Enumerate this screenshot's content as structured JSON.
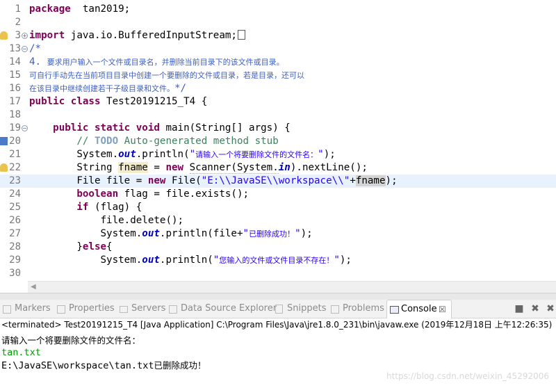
{
  "editor": {
    "lines": [
      {
        "num": "1",
        "tokens": [
          [
            "kw",
            "package"
          ],
          [
            "",
            "  tan2019;"
          ]
        ]
      },
      {
        "num": "2",
        "tokens": []
      },
      {
        "num": "3",
        "tokens": [
          [
            "kw",
            "import"
          ],
          [
            "",
            " java.io.BufferedInputStream;"
          ]
        ]
      },
      {
        "num": "13",
        "tokens": [
          [
            "jd",
            "/*"
          ]
        ]
      },
      {
        "num": "14",
        "tokens": [
          [
            "jd",
            "4. "
          ],
          [
            "jd cjk",
            "要求用户输入一个文件或目录名，并删除当前目录下的该文件或目录。"
          ]
        ]
      },
      {
        "num": "15",
        "tokens": [
          [
            "jd cjk",
            "可自行手动先在当前项目目录中创建一个要删除的文件或目录，若是目录，还可以"
          ]
        ]
      },
      {
        "num": "16",
        "tokens": [
          [
            "jd cjk",
            "在该目录中继续创建若干子级目录和文件。"
          ],
          [
            "jd",
            "*/"
          ]
        ]
      },
      {
        "num": "17",
        "tokens": [
          [
            "kw",
            "public"
          ],
          [
            "",
            " "
          ],
          [
            "kw",
            "class"
          ],
          [
            "",
            " Test20191215_T4 {"
          ]
        ]
      },
      {
        "num": "18",
        "tokens": []
      },
      {
        "num": "19",
        "tokens": [
          [
            "",
            "    "
          ],
          [
            "kw",
            "public"
          ],
          [
            "",
            " "
          ],
          [
            "kw",
            "static"
          ],
          [
            "",
            " "
          ],
          [
            "kw",
            "void"
          ],
          [
            "",
            " main(String[] args) {"
          ]
        ]
      },
      {
        "num": "20",
        "tokens": [
          [
            "",
            "        "
          ],
          [
            "cm",
            "// "
          ],
          [
            "cmtag",
            "TODO"
          ],
          [
            "cm",
            " Auto-generated method stub"
          ]
        ]
      },
      {
        "num": "21",
        "tokens": [
          [
            "",
            "        System."
          ],
          [
            "fld",
            "out"
          ],
          [
            "",
            ".println("
          ],
          [
            "str",
            "\""
          ],
          [
            "str cjk",
            "请输入一个将要删除文件的文件名："
          ],
          [
            "str",
            "\""
          ],
          [
            "",
            ");"
          ]
        ]
      },
      {
        "num": "22",
        "tokens": [
          [
            "",
            "        String "
          ],
          [
            "hlv",
            "fname"
          ],
          [
            "",
            " = "
          ],
          [
            "kw",
            "new"
          ],
          [
            "",
            " "
          ],
          [
            "warnu",
            "Scanner(System."
          ],
          [
            "fld",
            "in"
          ],
          [
            "",
            ").nextLine();"
          ]
        ]
      },
      {
        "num": "23",
        "tokens": [
          [
            "",
            "        File file = "
          ],
          [
            "kw",
            "new"
          ],
          [
            "",
            " File("
          ],
          [
            "str",
            "\"E:\\\\JavaSE\\\\workspace\\\\\""
          ],
          [
            "",
            "+"
          ],
          [
            "hl",
            "fname"
          ],
          [
            "",
            ");"
          ]
        ]
      },
      {
        "num": "24",
        "tokens": [
          [
            "",
            "        "
          ],
          [
            "kw",
            "boolean"
          ],
          [
            "",
            " flag = file.exists();"
          ]
        ]
      },
      {
        "num": "25",
        "tokens": [
          [
            "",
            "        "
          ],
          [
            "kw",
            "if"
          ],
          [
            "",
            " (flag) {"
          ]
        ]
      },
      {
        "num": "26",
        "tokens": [
          [
            "",
            "            file.delete();"
          ]
        ]
      },
      {
        "num": "27",
        "tokens": [
          [
            "",
            "            System."
          ],
          [
            "fld",
            "out"
          ],
          [
            "",
            ".println(file+"
          ],
          [
            "str",
            "\""
          ],
          [
            "str cjk",
            "已删除成功！"
          ],
          [
            "str",
            "\""
          ],
          [
            "",
            ");"
          ]
        ]
      },
      {
        "num": "28",
        "tokens": [
          [
            "",
            "        }"
          ],
          [
            "kw",
            "else"
          ],
          [
            "",
            "{"
          ]
        ]
      },
      {
        "num": "29",
        "tokens": [
          [
            "",
            "            System."
          ],
          [
            "fld",
            "out"
          ],
          [
            "",
            ".println("
          ],
          [
            "str",
            "\""
          ],
          [
            "str cjk",
            "您输入的文件或文件目录不存在！"
          ],
          [
            "str",
            "\""
          ],
          [
            "",
            ");"
          ]
        ]
      },
      {
        "num": "30",
        "tokens": []
      }
    ]
  },
  "tabs": [
    {
      "label": "Markers",
      "icon": "markers-icon"
    },
    {
      "label": "Properties",
      "icon": "properties-icon"
    },
    {
      "label": "Servers",
      "icon": "servers-icon"
    },
    {
      "label": "Data Source Explorer",
      "icon": "data-source-icon"
    },
    {
      "label": "Snippets",
      "icon": "snippets-icon"
    },
    {
      "label": "Problems",
      "icon": "problems-icon"
    },
    {
      "label": "Console",
      "icon": "console-icon",
      "close": "☒"
    }
  ],
  "console": {
    "status": "<terminated> Test20191215_T4 [Java Application] C:\\Program Files\\Java\\jre1.8.0_231\\bin\\javaw.exe (2019年12月18日 上午12:26:35)",
    "prompt": "请输入一个将要删除文件的文件名：",
    "input": "tan.txt",
    "result_path": "E:\\JavaSE\\workspace\\tan.txt",
    "result_msg": "已删除成功！"
  },
  "watermark": "https://blog.csdn.net/weixin_45292006",
  "colors": {
    "keyword": "#7f0055",
    "comment": "#3f7f5f",
    "javadoc": "#3f5fbf",
    "string": "#2a00ff",
    "field": "#0000c0",
    "current_line": "#e8f2fe",
    "console_input": "#009a00"
  }
}
